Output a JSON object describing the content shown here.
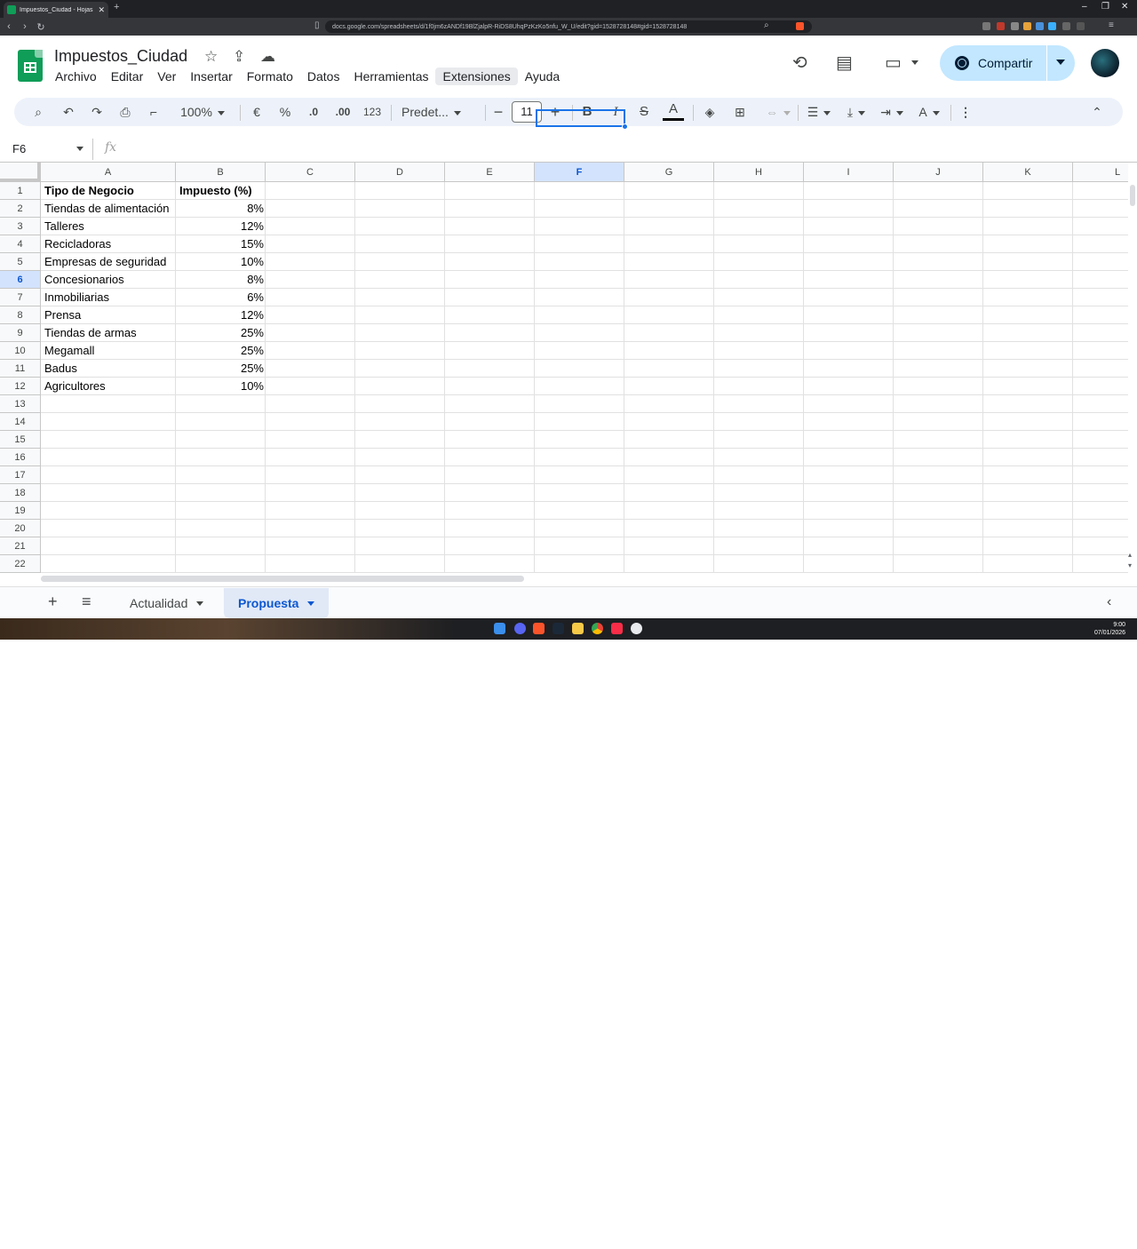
{
  "browser": {
    "tab_title": "Impuestos_Ciudad - Hojas de cálc",
    "url": "docs.google.com/spreadsheets/d/1f0jm6zANDf19BlZjalpR-RiDS8UhqPzKzKo5nfu_W_U/edit?gid=1528728148#gid=1528728148"
  },
  "app": {
    "title": "Impuestos_Ciudad",
    "menu": [
      "Archivo",
      "Editar",
      "Ver",
      "Insertar",
      "Formato",
      "Datos",
      "Herramientas",
      "Extensiones",
      "Ayuda"
    ],
    "share_label": "Compartir"
  },
  "toolbar": {
    "zoom": "100%",
    "currency": "€",
    "percent": "%",
    "dec_decrease": ".0",
    "dec_increase": ".00",
    "number_format": "123",
    "font": "Predet...",
    "font_size": "11",
    "bold": "B",
    "italic": "I",
    "strike": "S",
    "text_color": "A"
  },
  "formula_bar": {
    "name_box": "F6",
    "fx": "fx"
  },
  "grid": {
    "columns": [
      "A",
      "B",
      "C",
      "D",
      "E",
      "F",
      "G",
      "H",
      "I",
      "J",
      "K",
      "L"
    ],
    "selected_column": "F",
    "selected_row": "6",
    "rows": [
      "1",
      "2",
      "3",
      "4",
      "5",
      "6",
      "7",
      "8",
      "9",
      "10",
      "11",
      "12",
      "13",
      "14",
      "15",
      "16",
      "17",
      "18",
      "19",
      "20",
      "21",
      "22"
    ],
    "data": [
      [
        "Tipo de Negocio",
        "Impuesto (%)"
      ],
      [
        "Tiendas de alimentación",
        "8%"
      ],
      [
        "Talleres",
        "12%"
      ],
      [
        "Recicladoras",
        "15%"
      ],
      [
        "Empresas de seguridad",
        "10%"
      ],
      [
        "Concesionarios",
        "8%"
      ],
      [
        "Inmobiliarias",
        "6%"
      ],
      [
        "Prensa",
        "12%"
      ],
      [
        "Tiendas de armas",
        "25%"
      ],
      [
        "Megamall",
        "25%"
      ],
      [
        "Badus",
        "25%"
      ],
      [
        "Agricultores",
        "10%"
      ]
    ]
  },
  "sheets": {
    "add": "+",
    "list": "≡",
    "tabs": [
      "Actualidad",
      "Propuesta"
    ],
    "active": "Propuesta"
  },
  "taskbar": {
    "time": "9:00",
    "date": "07/01/2026"
  },
  "colors": {
    "accent": "#1a73e8",
    "sheets_green": "#0f9d58",
    "share_bg": "#c2e7ff",
    "toolbar_bg": "#edf2fa"
  }
}
